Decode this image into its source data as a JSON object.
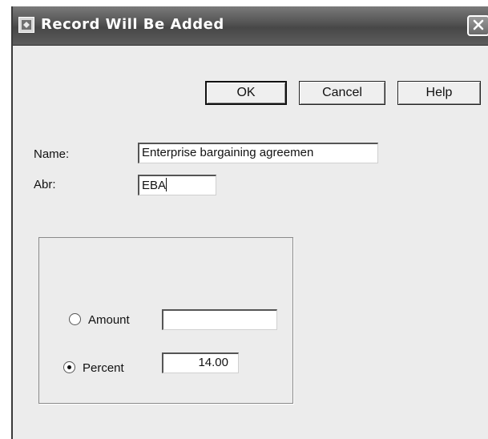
{
  "dialog": {
    "title": "Record Will Be Added",
    "title_icon": "app-window-icon",
    "close_icon": "close-icon"
  },
  "buttons": {
    "ok": "OK",
    "cancel": "Cancel",
    "help": "Help"
  },
  "form": {
    "name_label": "Name:",
    "name_value": "Enterprise bargaining agreemen",
    "abr_label": "Abr:",
    "abr_value": "EBA"
  },
  "rate": {
    "amount_label": "Amount",
    "amount_value": "",
    "amount_selected": false,
    "percent_label": "Percent",
    "percent_value": "14.00",
    "percent_selected": true
  }
}
